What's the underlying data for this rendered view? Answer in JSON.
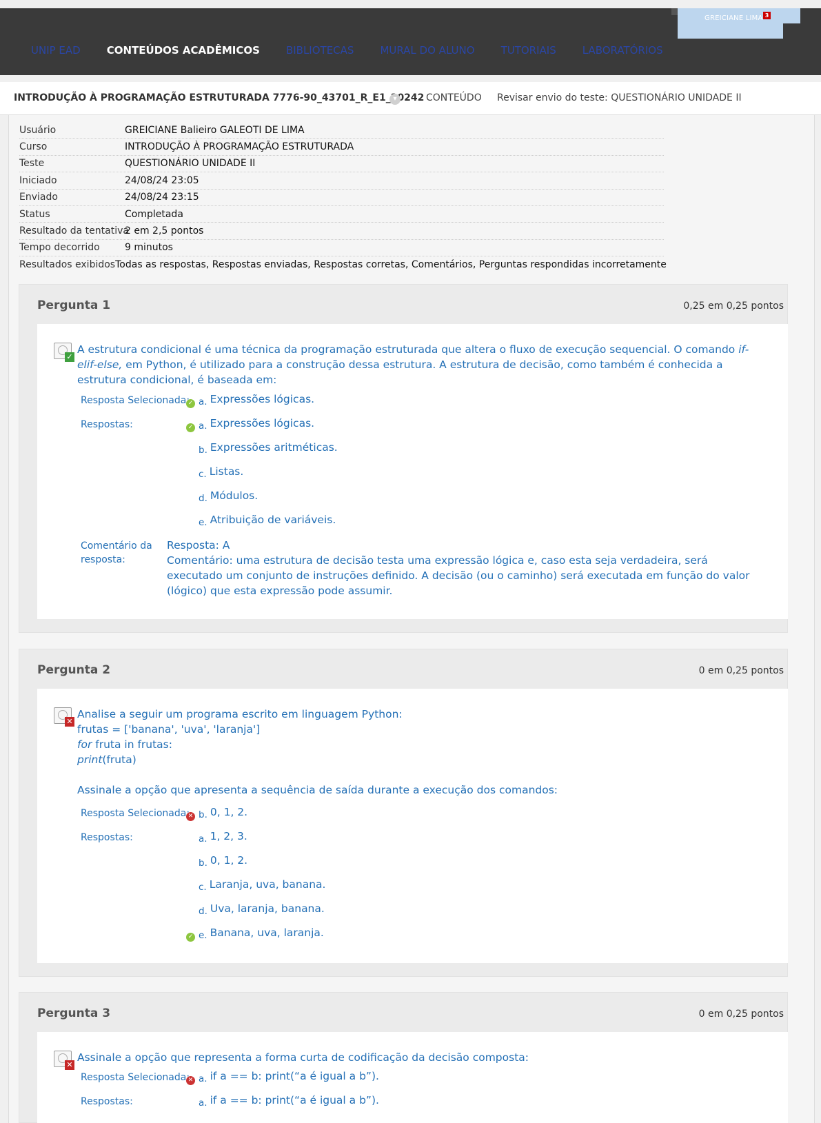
{
  "header": {
    "user_name": "GREICIANE LIMA",
    "notification_count": "3",
    "nav": [
      {
        "label": "UNIP EAD"
      },
      {
        "label": "CONTEÚDOS ACADÊMICOS"
      },
      {
        "label": "BIBLIOTECAS"
      },
      {
        "label": "MURAL DO ALUNO"
      },
      {
        "label": "TUTORIAIS"
      },
      {
        "label": "LABORATÓRIOS"
      }
    ]
  },
  "breadcrumb": {
    "course": "INTRODUÇÃO À PROGRAMAÇÃO ESTRUTURADA 7776-90_43701_R_E1_20242",
    "content": "CONTEÚDO",
    "page": "Revisar envio do teste: QUESTIONÁRIO UNIDADE II"
  },
  "info": [
    {
      "label": "Usuário",
      "value": "GREICIANE Balieiro GALEOTI DE LIMA"
    },
    {
      "label": "Curso",
      "value": "INTRODUÇÃO À PROGRAMAÇÃO ESTRUTURADA"
    },
    {
      "label": "Teste",
      "value": "QUESTIONÁRIO UNIDADE II"
    },
    {
      "label": "Iniciado",
      "value": "24/08/24 23:05"
    },
    {
      "label": "Enviado",
      "value": "24/08/24 23:15"
    },
    {
      "label": "Status",
      "value": "Completada"
    },
    {
      "label": "Resultado da tentativa",
      "value": "2 em 2,5 pontos"
    },
    {
      "label": "Tempo decorrido",
      "value": "9 minutos"
    },
    {
      "label": "Resultados exibidos",
      "value": "Todas as respostas, Respostas enviadas, Respostas corretas, Comentários, Perguntas respondidas incorretamente"
    }
  ],
  "labels": {
    "selected": "Resposta Selecionada:",
    "answers": "Respostas:",
    "comment_line1": "Comentário da",
    "comment_line2": "resposta:"
  },
  "questions": [
    {
      "title": "Pergunta 1",
      "score": "0,25 em 0,25 pontos",
      "text_part1": "A estrutura condicional é uma técnica da programação estruturada que altera o fluxo de execução sequencial. O comando ",
      "text_italic": "if-elif-else,",
      "text_part2": " em Python, é utilizado para a construção dessa estrutura. A estrutura de decisão, como também é conhecida a estrutura condicional, é baseada em:",
      "selected": {
        "letter": "a.",
        "text": "Expressões lógicas."
      },
      "answers": [
        {
          "letter": "a.",
          "text": "Expressões lógicas."
        },
        {
          "letter": "b.",
          "text": "Expressões aritméticas."
        },
        {
          "letter": "c.",
          "text": "Listas."
        },
        {
          "letter": "d.",
          "text": "Módulos."
        },
        {
          "letter": "e.",
          "text": "Atribuição de variáveis."
        }
      ],
      "comment_answer": "Resposta: A",
      "comment_text": "Comentário: uma estrutura de decisão testa uma expressão lógica e, caso esta seja verdadeira, será executado um conjunto de instruções definido. A decisão (ou o caminho) será executada em função do valor (lógico) que esta expressão pode assumir."
    },
    {
      "title": "Pergunta 2",
      "score": "0 em 0,25 pontos",
      "line1": "Analise a seguir um programa escrito em linguagem Python:",
      "line2": "frutas = ['banana', 'uva', 'laranja']",
      "line3_kw": "for",
      "line3_rest": " fruta in frutas:",
      "line4_kw": "print",
      "line4_rest": "(fruta)",
      "line5": "Assinale a opção que apresenta a sequência de saída durante a execução dos comandos:",
      "selected": {
        "letter": "b.",
        "text": "0, 1, 2."
      },
      "answers": [
        {
          "letter": "a.",
          "text": "1, 2, 3."
        },
        {
          "letter": "b.",
          "text": "0, 1, 2."
        },
        {
          "letter": "c.",
          "text": "Laranja, uva, banana."
        },
        {
          "letter": "d.",
          "text": "Uva, laranja, banana."
        },
        {
          "letter": "e.",
          "text": "Banana, uva, laranja."
        }
      ]
    },
    {
      "title": "Pergunta 3",
      "score": "0 em 0,25 pontos",
      "text": "Assinale a opção que representa a forma curta de codificação da decisão composta:",
      "selected": {
        "letter": "a.",
        "text": "if a == b: print(“a é igual a b”)."
      },
      "answers": [
        {
          "letter": "a.",
          "text": "if a == b: print(“a é igual a b”)."
        }
      ]
    }
  ]
}
